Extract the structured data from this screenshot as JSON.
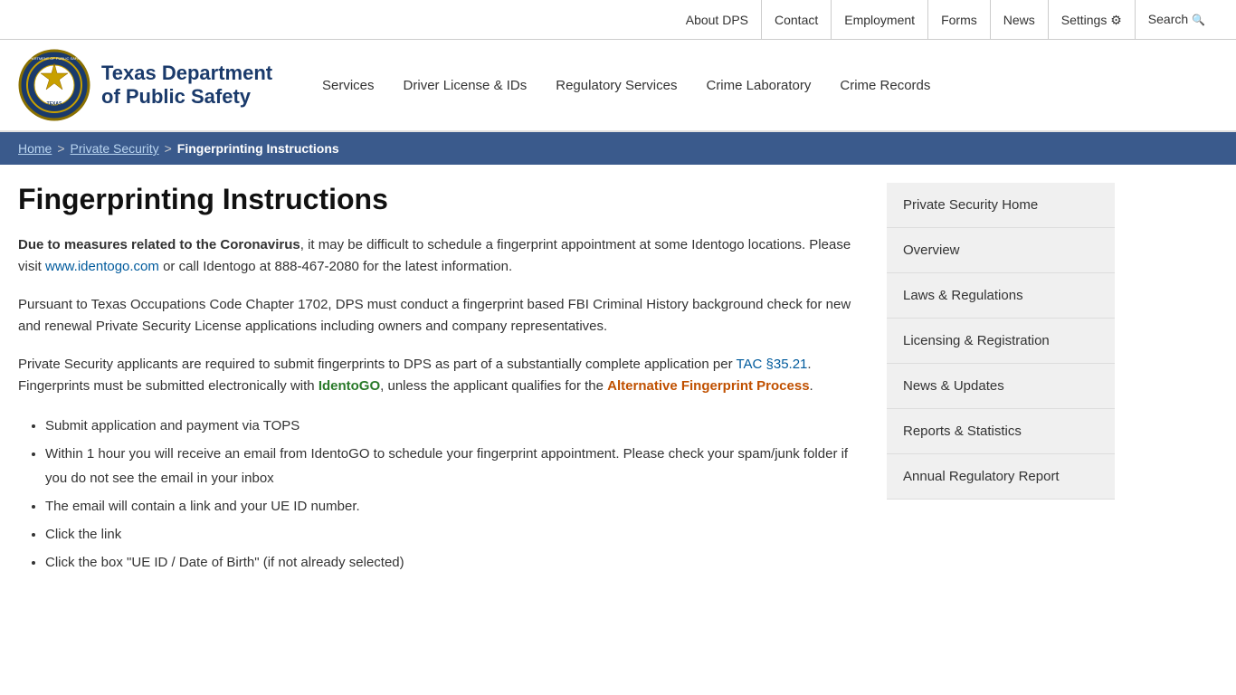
{
  "topbar": {
    "links": [
      {
        "id": "about-dps",
        "label": "About DPS"
      },
      {
        "id": "contact",
        "label": "Contact"
      },
      {
        "id": "employment",
        "label": "Employment"
      },
      {
        "id": "forms",
        "label": "Forms"
      },
      {
        "id": "news",
        "label": "News"
      },
      {
        "id": "settings",
        "label": "Settings"
      },
      {
        "id": "search",
        "label": "Search"
      }
    ]
  },
  "header": {
    "logo_alt": "Texas Department of Public Safety Seal",
    "org_name_line1": "Texas Department",
    "org_name_line2": "of Public Safety",
    "nav_items": [
      {
        "id": "services",
        "label": "Services"
      },
      {
        "id": "driver-license",
        "label": "Driver License & IDs"
      },
      {
        "id": "regulatory-services",
        "label": "Regulatory Services"
      },
      {
        "id": "crime-laboratory",
        "label": "Crime Laboratory"
      },
      {
        "id": "crime-records",
        "label": "Crime Records"
      }
    ]
  },
  "breadcrumb": {
    "items": [
      {
        "id": "home",
        "label": "Home",
        "href": true
      },
      {
        "id": "private-security",
        "label": "Private Security",
        "href": true
      },
      {
        "id": "current",
        "label": "Fingerprinting Instructions",
        "href": false
      }
    ]
  },
  "page": {
    "title": "Fingerprinting Instructions",
    "para1_bold": "Due to measures related to the Coronavirus",
    "para1_rest": ", it may be difficult to schedule a fingerprint appointment at some Identogo locations. Please visit ",
    "para1_link_text": "www.identogo.com",
    "para1_after_link": " or call Identogo at 888-467-2080 for the latest information.",
    "para2": "Pursuant to Texas Occupations Code Chapter 1702, DPS must conduct a fingerprint based FBI Criminal History background check for new and renewal Private Security License applications including owners and company representatives.",
    "para3_before": "Private Security applicants are required to submit fingerprints to DPS as part of a substantially complete application per ",
    "para3_link1": "TAC §35.21",
    "para3_mid": ". Fingerprints must be submitted electronically with ",
    "para3_link2": "IdentoGO",
    "para3_after": ", unless the applicant qualifies for the ",
    "para3_link3": "Alternative Fingerprint Process",
    "para3_end": ".",
    "bullet_points": [
      "Submit application and payment via TOPS",
      "Within 1 hour you will receive an email from IdentoGO to schedule your fingerprint appointment. Please check your spam/junk folder if you do not see the email in your inbox",
      "The email will contain a link and your UE ID number.",
      "Click the link",
      "Click the box \"UE ID / Date of Birth\" (if not already selected)"
    ]
  },
  "sidebar": {
    "items": [
      {
        "id": "private-security-home",
        "label": "Private Security Home"
      },
      {
        "id": "overview",
        "label": "Overview"
      },
      {
        "id": "laws-regulations",
        "label": "Laws & Regulations"
      },
      {
        "id": "licensing-registration",
        "label": "Licensing & Registration"
      },
      {
        "id": "news-updates",
        "label": "News & Updates"
      },
      {
        "id": "reports-statistics",
        "label": "Reports & Statistics"
      },
      {
        "id": "annual-regulatory-report",
        "label": "Annual Regulatory Report"
      }
    ]
  }
}
